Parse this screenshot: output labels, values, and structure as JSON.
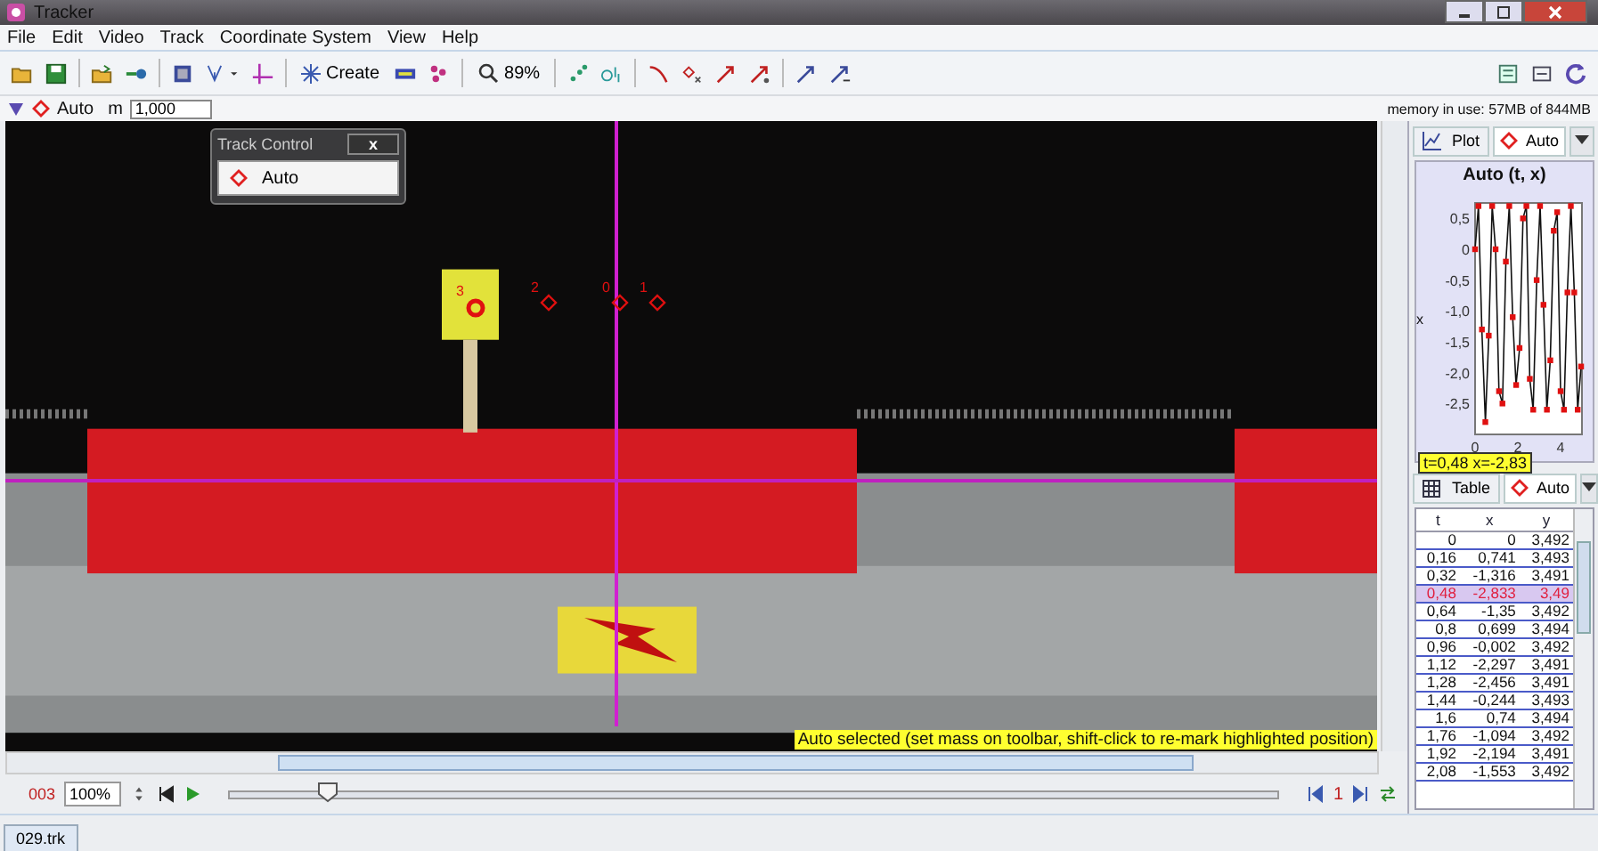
{
  "window": {
    "title": "Tracker"
  },
  "menu": [
    "File",
    "Edit",
    "Video",
    "Track",
    "Coordinate System",
    "View",
    "Help"
  ],
  "toolbar": {
    "create_label": "Create",
    "zoom": "89%"
  },
  "trackbar": {
    "track": "Auto",
    "mass_label": "m",
    "mass": "1,000",
    "memory": "memory in use: 57MB of 844MB"
  },
  "track_control": {
    "title": "Track Control",
    "close": "x",
    "track": "Auto"
  },
  "markers": [
    {
      "label": "3",
      "selected": true
    },
    {
      "label": "2",
      "selected": false
    },
    {
      "label": "0",
      "selected": false
    },
    {
      "label": "1",
      "selected": false
    }
  ],
  "status": "Auto selected (set mass on toolbar, shift-click to re-mark highlighted position)",
  "player": {
    "frame": "003",
    "zoom": "100%",
    "level": 0.095,
    "step": "1"
  },
  "plot": {
    "tab": "Plot",
    "track": "Auto",
    "readout": "t=0,48  x=-2,83",
    "chart_data": {
      "type": "line",
      "title": "Auto (t, x)",
      "ylabel": "x",
      "xlim": [
        0,
        5
      ],
      "ylim": [
        -3,
        0.75
      ],
      "xticks": [
        0,
        2,
        4
      ],
      "yticks": [
        {
          "value": 0.5,
          "label": "0,5"
        },
        {
          "value": 0,
          "label": "0"
        },
        {
          "value": -0.5,
          "label": "-0,5"
        },
        {
          "value": -1,
          "label": "-1,0"
        },
        {
          "value": -1.5,
          "label": "-1,5"
        },
        {
          "value": -2,
          "label": "-2,0"
        },
        {
          "value": -2.5,
          "label": "-2,5"
        }
      ],
      "x": [
        0,
        0.16,
        0.32,
        0.48,
        0.64,
        0.8,
        0.96,
        1.12,
        1.28,
        1.44,
        1.6,
        1.76,
        1.92,
        2.08,
        2.24,
        2.4,
        2.56,
        2.72,
        2.88,
        3.04,
        3.2,
        3.36,
        3.52,
        3.68,
        3.84,
        4.0,
        4.16,
        4.32,
        4.48,
        4.64,
        4.8,
        4.96
      ],
      "series": [
        {
          "color": "#e01010",
          "marker": "square",
          "values": [
            0,
            0.7,
            -1.3,
            -2.8,
            -1.4,
            0.7,
            0,
            -2.3,
            -2.5,
            -0.2,
            0.7,
            -1.1,
            -2.2,
            -1.6,
            0.5,
            0.7,
            -2.1,
            -2.6,
            -0.5,
            0.7,
            -0.9,
            -2.6,
            -1.8,
            0.3,
            0.6,
            -2.3,
            -2.6,
            -0.7,
            0.7,
            -0.7,
            -2.6,
            -1.9
          ]
        }
      ]
    }
  },
  "table": {
    "tab": "Table",
    "track": "Auto",
    "columns": [
      "t",
      "x",
      "y"
    ],
    "rows": [
      {
        "cells": [
          "0",
          "0",
          "3,492"
        ],
        "selected": false
      },
      {
        "cells": [
          "0,16",
          "0,741",
          "3,493"
        ],
        "selected": false
      },
      {
        "cells": [
          "0,32",
          "-1,316",
          "3,491"
        ],
        "selected": false
      },
      {
        "cells": [
          "0,48",
          "-2,833",
          "3,49"
        ],
        "selected": true
      },
      {
        "cells": [
          "0,64",
          "-1,35",
          "3,492"
        ],
        "selected": false
      },
      {
        "cells": [
          "0,8",
          "0,699",
          "3,494"
        ],
        "selected": false
      },
      {
        "cells": [
          "0,96",
          "-0,002",
          "3,492"
        ],
        "selected": false
      },
      {
        "cells": [
          "1,12",
          "-2,297",
          "3,491"
        ],
        "selected": false
      },
      {
        "cells": [
          "1,28",
          "-2,456",
          "3,491"
        ],
        "selected": false
      },
      {
        "cells": [
          "1,44",
          "-0,244",
          "3,493"
        ],
        "selected": false
      },
      {
        "cells": [
          "1,6",
          "0,74",
          "3,494"
        ],
        "selected": false
      },
      {
        "cells": [
          "1,76",
          "-1,094",
          "3,492"
        ],
        "selected": false
      },
      {
        "cells": [
          "1,92",
          "-2,194",
          "3,491"
        ],
        "selected": false
      },
      {
        "cells": [
          "2,08",
          "-1,553",
          "3,492"
        ],
        "selected": false
      }
    ]
  },
  "file_tab": "029.trk"
}
